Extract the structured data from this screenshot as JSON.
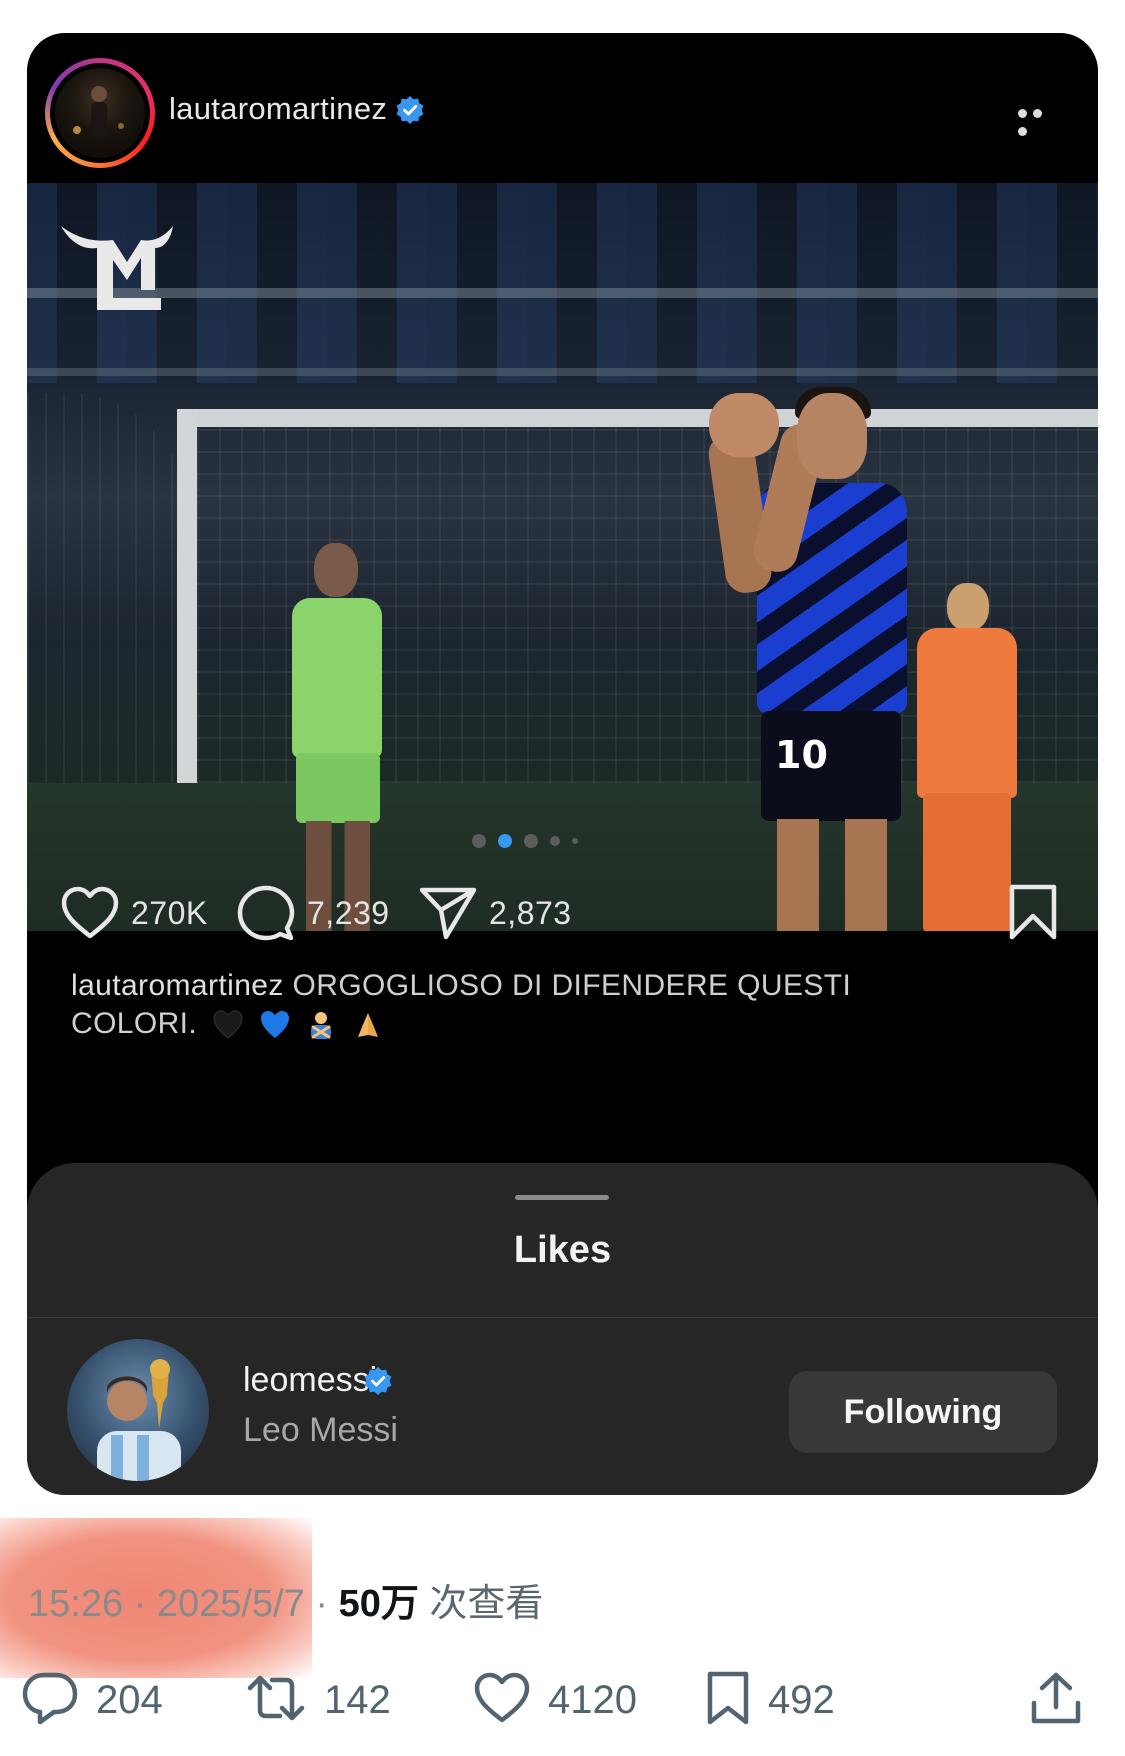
{
  "post": {
    "username": "lautaromartinez",
    "verified": true,
    "more_icon": "more-dots-icon",
    "carousel": {
      "count": 5,
      "active_index": 1
    },
    "likes": "270K",
    "comments": "7,239",
    "shares": "2,873",
    "caption_user": "lautaromartinez",
    "caption_text": "ORGOGLIOSO DI DIFENDERE QUESTI COLORI.",
    "caption_emojis": [
      "black-heart-emoji",
      "blue-heart-emoji",
      "person-gesturing-no-emoji",
      "folded-hands-emoji"
    ],
    "photo_jersey_number": "10"
  },
  "likes_sheet": {
    "title": "Likes",
    "user": {
      "username": "leomessi",
      "verified": true,
      "full_name": "Leo Messi",
      "follow_label": "Following"
    }
  },
  "tweet_meta": {
    "time": "15:26",
    "separator": "·",
    "date": "2025/5/7",
    "views": "50万",
    "views_suffix": "次查看"
  },
  "tweet_actions": {
    "replies": "204",
    "retweets": "142",
    "likes": "4120",
    "bookmarks": "492"
  },
  "colors": {
    "verified_blue": "#3897f0",
    "redaction": "#ee806e",
    "x_gray": "#536471"
  }
}
